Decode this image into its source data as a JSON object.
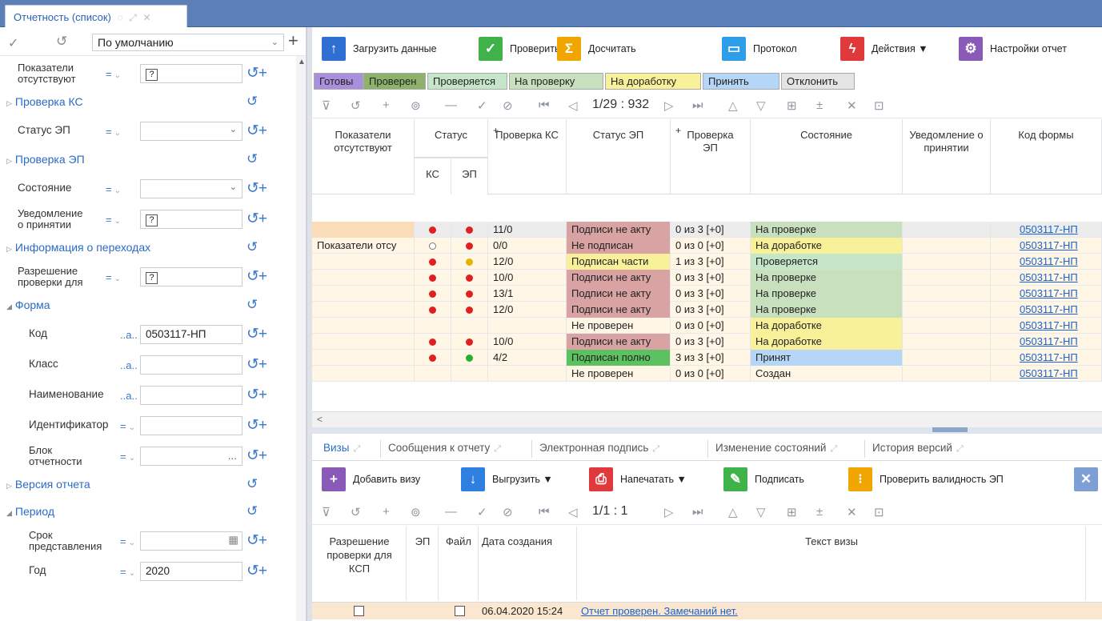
{
  "tab": {
    "title": "Отчетность (список)"
  },
  "left": {
    "preset": "По умолчанию",
    "rows": [
      {
        "label1": "Показатели",
        "label2": "отсутствуют",
        "op": "=",
        "value": "?",
        "qmark": true
      },
      {
        "group": "Проверка КС"
      },
      {
        "label1": "Статус ЭП",
        "op": "=",
        "value": "",
        "dropdown": true
      },
      {
        "group": "Проверка ЭП"
      },
      {
        "label1": "Состояние",
        "op": "=",
        "value": "",
        "dropdown": true
      },
      {
        "label1": "Уведомление",
        "label2": "о принятии",
        "op": "=",
        "value": "?",
        "qmark": true
      },
      {
        "group": "Информация о переходах"
      },
      {
        "label1": "Разрешение",
        "label2": "проверки для",
        "op": "=",
        "value": "?",
        "qmark": true
      },
      {
        "group": "Форма",
        "open": true
      },
      {
        "label1": "Код",
        "op": "..a..",
        "value": "0503117-НП",
        "indent": true
      },
      {
        "label1": "Класс",
        "op": "..a..",
        "value": "",
        "indent": true
      },
      {
        "label1": "Наименование",
        "op": "..a..",
        "value": "",
        "indent": true
      },
      {
        "label1": "Идентификатор",
        "op": "=",
        "value": "",
        "indent": true
      },
      {
        "label1": "Блок",
        "label2": "отчетности",
        "op": "=",
        "value": "...",
        "indent": true
      },
      {
        "group": "Версия отчета"
      },
      {
        "group": "Период",
        "open": true
      },
      {
        "label1": "Срок",
        "label2": "представления",
        "op": "=",
        "value": "",
        "cal": true,
        "indent": true
      },
      {
        "label1": "Год",
        "op": "=",
        "value": "2020",
        "indent": true
      }
    ]
  },
  "actions": [
    {
      "label": "Загрузить данные",
      "icon": "upload-data-icon",
      "color": "#2f6fd1"
    },
    {
      "label": "Проверить",
      "icon": "check-icon",
      "color": "#3fb24a"
    },
    {
      "label": "Досчитать",
      "icon": "calculate-icon",
      "color": "#f0a500"
    },
    {
      "label": "Протокол",
      "icon": "protocol-icon",
      "color": "#2e9ee8"
    },
    {
      "label": "Действия ▼",
      "icon": "actions-icon",
      "color": "#e0393b"
    },
    {
      "label": "Настройки отчет",
      "icon": "settings-icon",
      "color": "#8a5ab8"
    }
  ],
  "status_buttons": [
    {
      "label": "Готовы",
      "bg": "#a98fdc"
    },
    {
      "label": "Проверен",
      "bg": "#8db36a"
    },
    {
      "label": "Проверяется",
      "bg": "#c6e6c9"
    },
    {
      "label": "На проверку",
      "bg": "#c8e0bd"
    },
    {
      "label": "На доработку",
      "bg": "#f8f19a"
    },
    {
      "label": "Принять",
      "bg": "#b5d6f6"
    },
    {
      "label": "Отклонить",
      "bg": "#e4e4e4"
    }
  ],
  "pager_top": "1/29 : 932",
  "pager_bottom": "1/1 : 1",
  "grid_headers": {
    "c1": "Показатели отсутствуют",
    "c2": "Статус",
    "c2a": "КС",
    "c2b": "ЭП",
    "c3": "Проверка КС",
    "c4": "Статус ЭП",
    "c5": "Проверка ЭП",
    "c6": "Состояние",
    "c7": "Уведомление о принятии",
    "c8": "Код формы"
  },
  "rows": [
    {
      "c1": "",
      "ks": "red",
      "ep": "red",
      "kc": "11/0",
      "sep": "Подписи не акту",
      "pep": "0 из 3 [+0]",
      "state": "На проверке",
      "code": "0503117-НП",
      "sepbg": "#d9a3a3",
      "statebg": "#c8e0bd",
      "rowbg": "#fbe6cf",
      "sel": true
    },
    {
      "c1": "Показатели отсу",
      "ks": "empty",
      "ep": "red",
      "kc": "0/0",
      "sep": "Не подписан",
      "pep": "0 из 0 [+0]",
      "state": "На доработке",
      "code": "0503117-НП",
      "sepbg": "#d9a3a3",
      "statebg": "#f8f19a",
      "rowbg": "#fff6e6"
    },
    {
      "c1": "",
      "ks": "red",
      "ep": "yellow",
      "kc": "12/0",
      "sep": "Подписан части",
      "pep": "1 из 3 [+0]",
      "state": "Проверяется",
      "code": "0503117-НП",
      "sepbg": "#f8f19a",
      "statebg": "#c6e6c9",
      "rowbg": "#fff6e6"
    },
    {
      "c1": "",
      "ks": "red",
      "ep": "red",
      "kc": "10/0",
      "sep": "Подписи не акту",
      "pep": "0 из 3 [+0]",
      "state": "На проверке",
      "code": "0503117-НП",
      "sepbg": "#d9a3a3",
      "statebg": "#c8e0bd",
      "rowbg": "#fff6e6"
    },
    {
      "c1": "",
      "ks": "red",
      "ep": "red",
      "kc": "13/1",
      "sep": "Подписи не акту",
      "pep": "0 из 3 [+0]",
      "state": "На проверке",
      "code": "0503117-НП",
      "sepbg": "#d9a3a3",
      "statebg": "#c8e0bd",
      "rowbg": "#fff6e6"
    },
    {
      "c1": "",
      "ks": "red",
      "ep": "red",
      "kc": "12/0",
      "sep": "Подписи не акту",
      "pep": "0 из 3 [+0]",
      "state": "На проверке",
      "code": "0503117-НП",
      "sepbg": "#d9a3a3",
      "statebg": "#c8e0bd",
      "rowbg": "#fff6e6"
    },
    {
      "c1": "",
      "ks": "",
      "ep": "",
      "kc": "",
      "sep": "Не проверен",
      "pep": "0 из 0 [+0]",
      "state": "На доработке",
      "code": "0503117-НП",
      "sepbg": "",
      "statebg": "#f8f19a",
      "rowbg": "#fff6e6"
    },
    {
      "c1": "",
      "ks": "red",
      "ep": "red",
      "kc": "10/0",
      "sep": "Подписи не акту",
      "pep": "0 из 3 [+0]",
      "state": "На доработке",
      "code": "0503117-НП",
      "sepbg": "#d9a3a3",
      "statebg": "#f8f19a",
      "rowbg": "#fff6e6"
    },
    {
      "c1": "",
      "ks": "red",
      "ep": "green",
      "kc": "4/2",
      "sep": "Подписан полно",
      "pep": "3 из 3 [+0]",
      "state": "Принят",
      "code": "0503117-НП",
      "sepbg": "#5cc261",
      "statebg": "#b5d6f6",
      "rowbg": "#fff6e6"
    },
    {
      "c1": "",
      "ks": "",
      "ep": "",
      "kc": "",
      "sep": "Не проверен",
      "pep": "0 из 0 [+0]",
      "state": "Создан",
      "code": "0503117-НП",
      "sepbg": "",
      "statebg": "",
      "rowbg": "#fff6e6"
    }
  ],
  "bottom_tabs": [
    "Визы",
    "Сообщения к отчету",
    "Электронная подпись",
    "Изменение состояний",
    "История версий"
  ],
  "bottom_actions": [
    {
      "label": "Добавить визу",
      "icon": "add-icon",
      "color": "#8a5ab8"
    },
    {
      "label": "Выгрузить ▼",
      "icon": "download-icon",
      "color": "#2e7fe0"
    },
    {
      "label": "Напечатать ▼",
      "icon": "print-icon",
      "color": "#e0393b"
    },
    {
      "label": "Подписать",
      "icon": "sign-icon",
      "color": "#3fb24a"
    },
    {
      "label": "Проверить валидность ЭП",
      "icon": "validate-icon",
      "color": "#f0a500"
    }
  ],
  "bottom_headers": {
    "a": "Разрешение проверки для КСП",
    "b": "ЭП",
    "c": "Файл",
    "d": "Дата создания",
    "e": "Текст визы"
  },
  "bottom_row": {
    "date": "06.04.2020 15:24",
    "text": "Отчет проверен. Замечаний нет."
  }
}
